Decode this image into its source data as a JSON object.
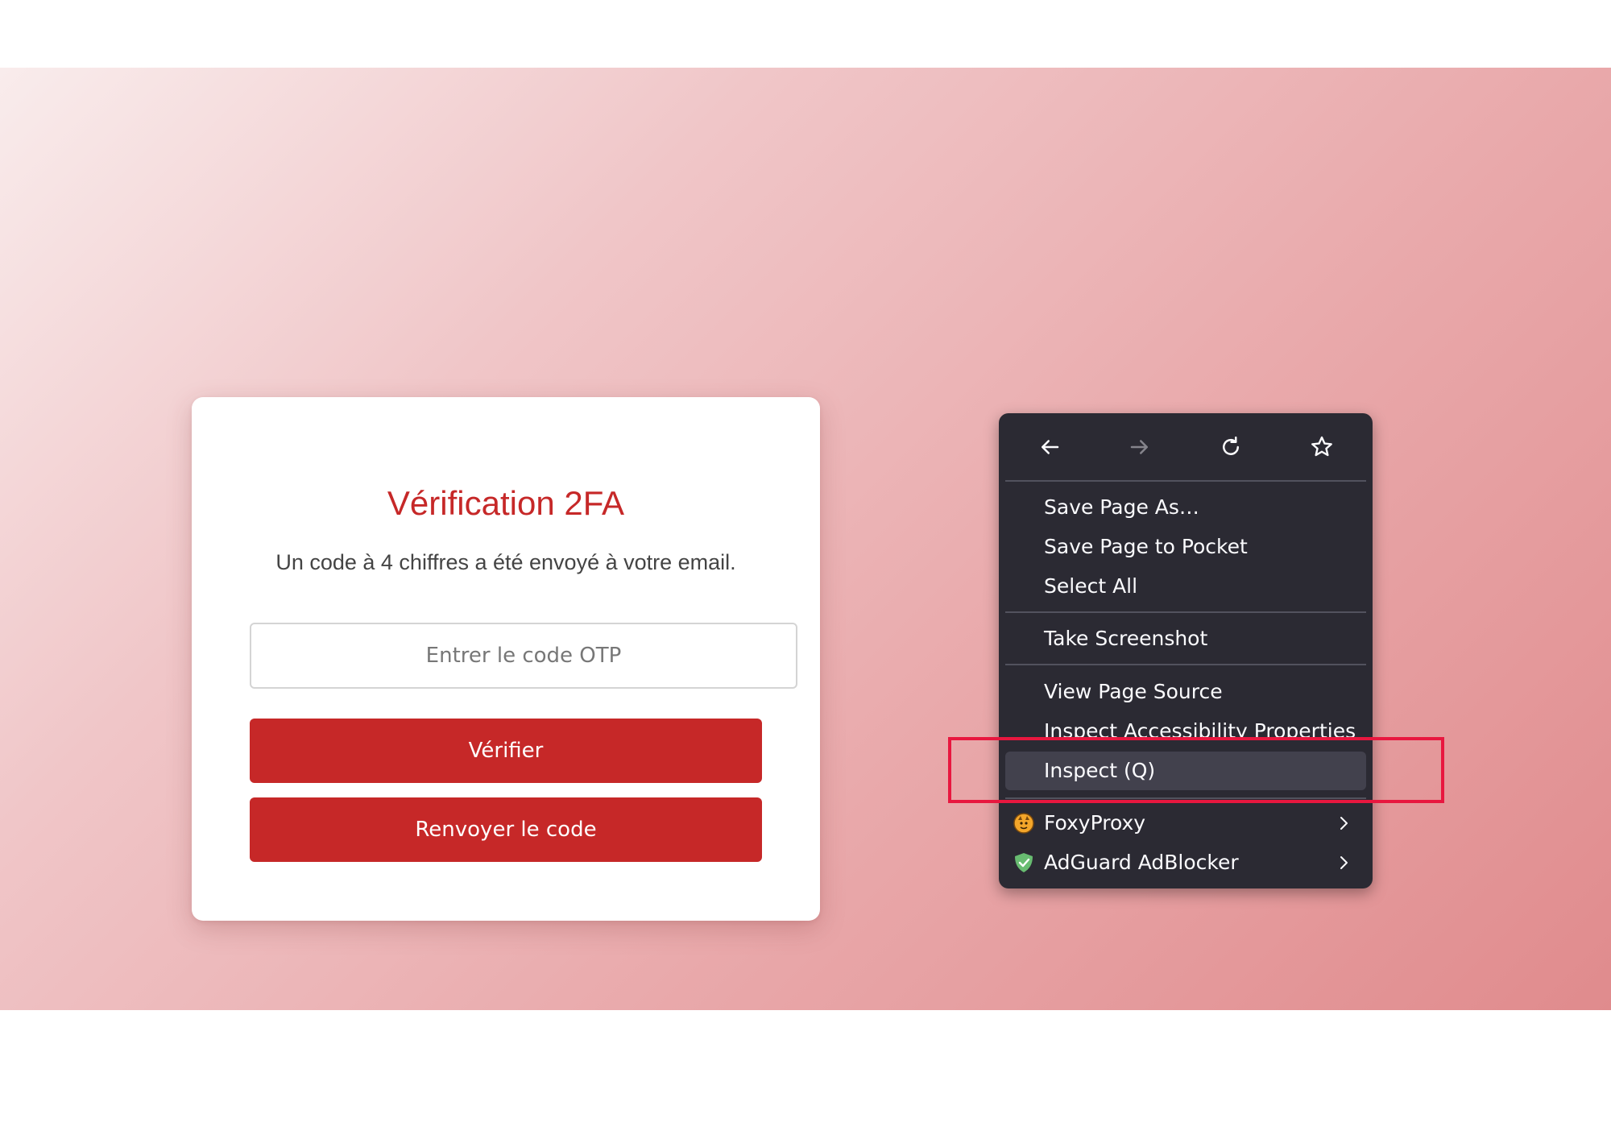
{
  "card": {
    "title": "Vérification 2FA",
    "subtitle": "Un code à 4 chiffres a été envoyé à votre email.",
    "otp_placeholder": "Entrer le code OTP",
    "otp_value": "",
    "verify_label": "Vérifier",
    "resend_label": "Renvoyer le code"
  },
  "colors": {
    "accent": "#c62828",
    "menu_bg": "#2b2a33",
    "menu_highlight": "#42414d",
    "annotation_box": "#e8173f"
  },
  "context_menu": {
    "nav_icons": [
      "back-arrow-icon",
      "forward-arrow-icon",
      "reload-icon",
      "bookmark-star-icon"
    ],
    "items": [
      {
        "label": "Save Page As…",
        "icon": null
      },
      {
        "label": "Save Page to Pocket",
        "icon": null
      },
      {
        "label": "Select All",
        "icon": null
      },
      {
        "label": "Take Screenshot",
        "icon": null
      },
      {
        "label": "View Page Source",
        "icon": null
      },
      {
        "label": "Inspect Accessibility Properties",
        "icon": null
      },
      {
        "label": "Inspect (Q)",
        "icon": null,
        "highlighted": true
      },
      {
        "label": "FoxyProxy",
        "icon": "foxyproxy-icon",
        "submenu": true
      },
      {
        "label": "AdGuard AdBlocker",
        "icon": "adguard-shield-icon",
        "submenu": true
      }
    ]
  }
}
